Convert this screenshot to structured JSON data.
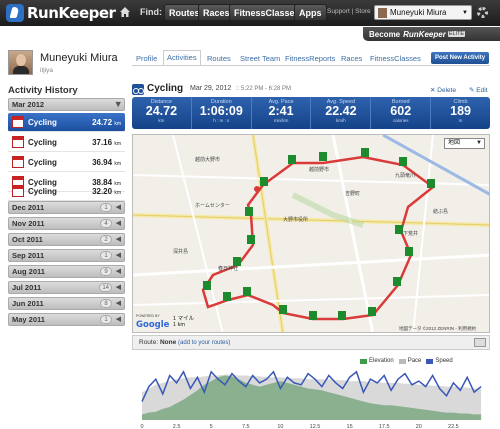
{
  "topbar": {
    "logo": "RunKeeper",
    "find_label": "Find:",
    "nav": [
      "Routes",
      "Races",
      "FitnessClasses",
      "Apps"
    ],
    "support": "Support | Store",
    "user": "Muneyuki Miura",
    "elite": {
      "become": "Become",
      "brand": "RunKeeper",
      "badge": "ELITE"
    }
  },
  "profile": {
    "name": "Muneyuki Miura",
    "subtitle": "itjiya",
    "tabs": [
      "Profile",
      "Activities",
      "Routes",
      "Street Team",
      "FitnessReports",
      "Races",
      "FitnessClasses"
    ],
    "active_tab": "Activities",
    "post_button": "Post New Activity"
  },
  "history": {
    "title": "Activity History",
    "current_month": "Mar 2012",
    "activities": [
      {
        "type": "Cycling",
        "distance": "24.72",
        "unit": "km"
      },
      {
        "type": "Cycling",
        "distance": "37.16",
        "unit": "km"
      },
      {
        "type": "Cycling",
        "distance": "36.94",
        "unit": "km"
      },
      {
        "type": "Cycling",
        "distance": "38.84",
        "unit": "km"
      },
      {
        "type": "Cycling",
        "distance": "32.20",
        "unit": "km"
      }
    ],
    "months": [
      {
        "label": "Dec 2011",
        "count": "1"
      },
      {
        "label": "Nov 2011",
        "count": "4"
      },
      {
        "label": "Oct 2011",
        "count": "2"
      },
      {
        "label": "Sep 2011",
        "count": "1"
      },
      {
        "label": "Aug 2011",
        "count": "9"
      },
      {
        "label": "Jul 2011",
        "count": "14"
      },
      {
        "label": "Jun 2011",
        "count": "8"
      },
      {
        "label": "May 2011",
        "count": "1"
      }
    ]
  },
  "activity": {
    "title": "Cycling",
    "date": "Mar 29, 2012",
    "time": ":: 5:22 PM - 6:28 PM",
    "delete": "Delete",
    "edit": "Edit",
    "stats": [
      {
        "label": "Distance",
        "value": "24.72",
        "unit": "km"
      },
      {
        "label": "Duration",
        "value": "1:06:09",
        "unit": "h : m : s"
      },
      {
        "label": "Avg. Pace",
        "value": "2:41",
        "unit": "min/km"
      },
      {
        "label": "Avg. Speed",
        "value": "22.42",
        "unit": "km/h"
      },
      {
        "label": "Burned",
        "value": "602",
        "unit": "calories"
      },
      {
        "label": "Climb",
        "value": "189",
        "unit": "m"
      }
    ]
  },
  "map": {
    "type_select": "地図",
    "scale_top": "1 マイル",
    "scale_bottom": "1 km",
    "powered": "POWERED BY",
    "google": "Google",
    "attribution": "地図データ ©2012 ZENRIN - 利用規約",
    "place_labels": [
      "越前大野市",
      "越前野市",
      "大野市役所",
      "下荒井",
      "結ぶ島",
      "春日神社",
      "深井島",
      "九頭竜川",
      "吉野町",
      "ホームセンター"
    ],
    "route_color": "#d93a3a",
    "marker_color": "#1e8a2e"
  },
  "route": {
    "label": "Route:",
    "value": "None",
    "link": "(add to your routes)"
  },
  "legend": {
    "items": [
      {
        "name": "Elevation",
        "color": "#3d9b4a"
      },
      {
        "name": "Pace",
        "color": "#b9b9b9"
      },
      {
        "name": "Speed",
        "color": "#3957b8"
      }
    ]
  },
  "chart_data": {
    "type": "area",
    "x": [
      0,
      0.5,
      1,
      1.5,
      2,
      2.5,
      3,
      3.5,
      4,
      4.5,
      5,
      5.5,
      6,
      6.5,
      7,
      7.5,
      8,
      8.5,
      9,
      9.5,
      10,
      10.5,
      11,
      11.5,
      12,
      12.5,
      13,
      13.5,
      14,
      14.5,
      15,
      15.5,
      16,
      16.5,
      17,
      17.5,
      18,
      18.5,
      19,
      19.5,
      20,
      20.5,
      21,
      21.5,
      22,
      22.5,
      23,
      23.5,
      24,
      24.5
    ],
    "xticks": [
      "0",
      "2.5",
      "5",
      "7.5",
      "10",
      "12.5",
      "15",
      "17.5",
      "20",
      "22.5"
    ],
    "series": [
      {
        "name": "Elevation",
        "values": [
          6,
          8,
          9,
          12,
          14,
          18,
          22,
          27,
          32,
          38,
          42,
          46,
          48,
          47,
          44,
          40,
          38,
          36,
          38,
          40,
          42,
          40,
          38,
          36,
          34,
          33,
          32,
          30,
          28,
          26,
          24,
          22,
          20,
          18,
          17,
          16,
          16,
          15,
          14,
          13,
          12,
          11,
          10,
          9,
          8,
          8,
          7,
          7,
          6,
          6
        ]
      },
      {
        "name": "Pace",
        "values": [
          30,
          34,
          38,
          40,
          42,
          44,
          45,
          46,
          46,
          47,
          48,
          48,
          49,
          49,
          48,
          48,
          47,
          47,
          46,
          46,
          46,
          45,
          45,
          45,
          44,
          44,
          44,
          44,
          43,
          43,
          42,
          42,
          42,
          41,
          41,
          40,
          40,
          40,
          39,
          39,
          38,
          38,
          37,
          37,
          36,
          36,
          35,
          35,
          34,
          34
        ]
      },
      {
        "name": "Speed",
        "values": [
          20,
          36,
          44,
          28,
          48,
          40,
          52,
          34,
          46,
          30,
          52,
          44,
          38,
          50,
          42,
          36,
          48,
          40,
          44,
          52,
          34,
          46,
          40,
          38,
          50,
          44,
          36,
          48,
          40,
          34,
          46,
          52,
          30,
          44,
          40,
          48,
          32,
          44,
          50,
          38,
          42,
          36,
          48,
          34,
          26,
          40,
          32,
          46,
          30,
          36
        ]
      }
    ],
    "ylim": [
      0,
      55
    ]
  }
}
